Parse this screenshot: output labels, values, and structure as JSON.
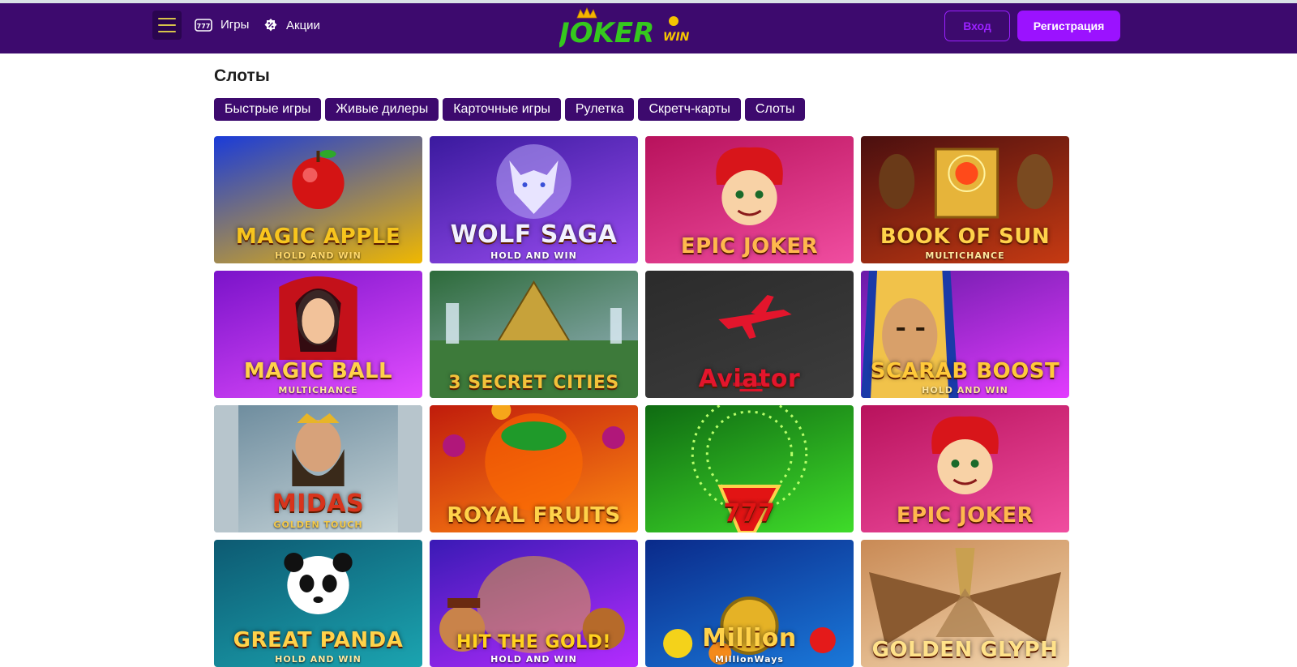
{
  "header": {
    "nav": [
      {
        "label": "Игры",
        "icon": "slot-777-icon"
      },
      {
        "label": "Акции",
        "icon": "percent-badge-icon"
      }
    ],
    "logo": {
      "main": "JOKER",
      "sub": "WIN"
    },
    "login_label": "Вход",
    "register_label": "Регистрация"
  },
  "page": {
    "title": "Слоты"
  },
  "categories": [
    "Быстрые игры",
    "Живые дилеры",
    "Карточные игры",
    "Рулетка",
    "Скретч-карты",
    "Слоты"
  ],
  "games": [
    {
      "title": "MAGIC APPLE",
      "subtitle": "HOLD AND WIN",
      "bg1": "#1a3bd9",
      "bg2": "#f0b800",
      "title_color": "#f7c51e",
      "sub_color": "#ffd86a",
      "art": "apple"
    },
    {
      "title": "WOLF SAGA",
      "subtitle": "HOLD AND WIN",
      "bg1": "#3a1a9e",
      "bg2": "#9a4cf0",
      "title_color": "#f1f1ff",
      "sub_color": "#ffffff",
      "art": "wolf"
    },
    {
      "title": "EPIC JOKER",
      "subtitle": "",
      "bg1": "#b8125c",
      "bg2": "#f04da0",
      "title_color": "#ffb84d",
      "sub_color": "#ffffff",
      "art": "joker"
    },
    {
      "title": "BOOK OF SUN",
      "subtitle": "MULTICHANCE",
      "bg1": "#4a0f0f",
      "bg2": "#c63a12",
      "title_color": "#ffd24a",
      "sub_color": "#ffe9a0",
      "art": "book"
    },
    {
      "title": "MAGIC BALL",
      "subtitle": "MULTICHANCE",
      "bg1": "#7a13c9",
      "bg2": "#e24cff",
      "title_color": "#ffd24a",
      "sub_color": "#ffe9a0",
      "art": "lady"
    },
    {
      "title": "3 SECRET CITIES",
      "subtitle": "",
      "bg1": "#2d6b3a",
      "bg2": "#9fb8c9",
      "title_color": "#f3c23a",
      "sub_color": "#ffffff",
      "art": "pyramid"
    },
    {
      "title": "Aviator",
      "subtitle": "",
      "bg1": "#2b2b2b",
      "bg2": "#3d3d3d",
      "title_color": "#e3152c",
      "sub_color": "#e3152c",
      "art": "plane"
    },
    {
      "title": "SCARAB BOOST",
      "subtitle": "HOLD AND WIN",
      "bg1": "#6a1aa8",
      "bg2": "#e23cff",
      "title_color": "#ffc93a",
      "sub_color": "#ffe59a",
      "art": "pharaoh"
    },
    {
      "title": "MIDAS",
      "subtitle": "GOLDEN TOUCH",
      "bg1": "#6b8a9c",
      "bg2": "#c9d6da",
      "title_color": "#d8341c",
      "sub_color": "#f3c94a",
      "art": "king"
    },
    {
      "title": "ROYAL FRUITS",
      "subtitle": "",
      "bg1": "#c01c0c",
      "bg2": "#ff8a12",
      "title_color": "#ffd24a",
      "sub_color": "#ffffff",
      "art": "fruits"
    },
    {
      "title": "777",
      "subtitle": "",
      "bg1": "#0f6b12",
      "bg2": "#3fdc2a",
      "title_color": "#e21414",
      "sub_color": "#ffffff",
      "art": "sevens"
    },
    {
      "title": "EPIC JOKER",
      "subtitle": "",
      "bg1": "#b8125c",
      "bg2": "#f04da0",
      "title_color": "#ffb84d",
      "sub_color": "#ffffff",
      "art": "joker"
    },
    {
      "title": "GREAT PANDA",
      "subtitle": "HOLD AND WIN",
      "bg1": "#0d5a72",
      "bg2": "#1ba4b0",
      "title_color": "#ffd24a",
      "sub_color": "#ffe9a0",
      "art": "panda"
    },
    {
      "title": "HIT THE GOLD!",
      "subtitle": "HOLD AND WIN",
      "bg1": "#3a1ab5",
      "bg2": "#b42cff",
      "title_color": "#ffd21e",
      "sub_color": "#ffffff",
      "art": "gold"
    },
    {
      "title": "Million",
      "subtitle": "MillionWays",
      "bg1": "#0a2a8a",
      "bg2": "#1a78d9",
      "title_color": "#ffd24a",
      "sub_color": "#ffffff",
      "art": "coin"
    },
    {
      "title": "GOLDEN GLYPH",
      "subtitle": "",
      "bg1": "#c98a55",
      "bg2": "#f3d7b0",
      "title_color": "#ffe28a",
      "sub_color": "#ffffff",
      "art": "wings"
    }
  ]
}
